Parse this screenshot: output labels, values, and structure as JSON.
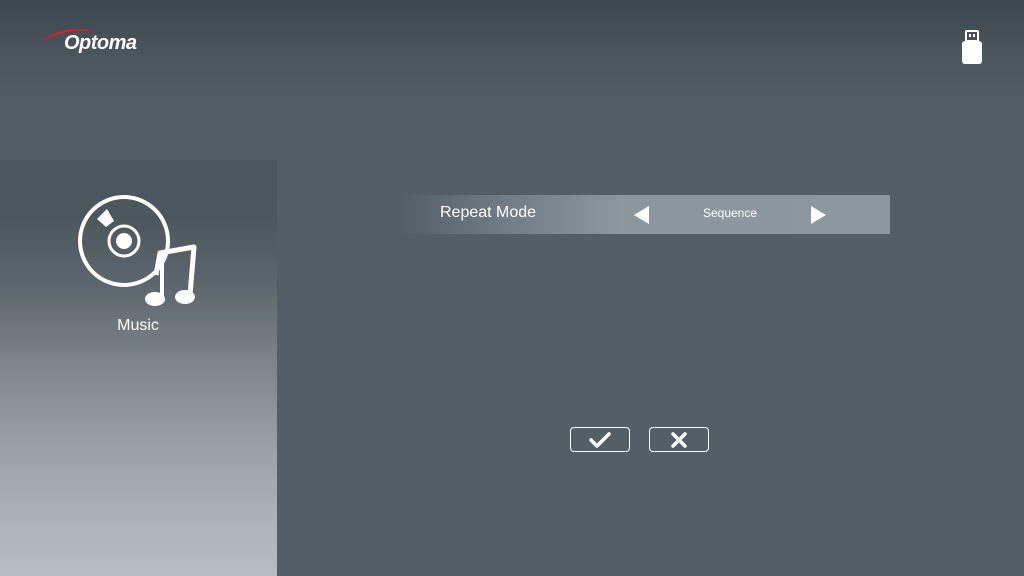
{
  "header": {
    "brand_name": "Optoma",
    "brand_logo_icon": "optoma-logo",
    "status_icon": "usb-drive-icon"
  },
  "sidebar": {
    "category_icon": "music-disc-note-icon",
    "category_label": "Music"
  },
  "settings": {
    "rows": [
      {
        "label": "Repeat Mode",
        "value": "Sequence",
        "prev_icon": "triangle-left-icon",
        "next_icon": "triangle-right-icon"
      }
    ]
  },
  "actions": {
    "confirm_icon": "checkmark-icon",
    "cancel_icon": "cross-icon"
  },
  "colors": {
    "background": "#535e66",
    "row_highlight": "#8c969d",
    "brand_red": "#d8202a",
    "foreground": "#ffffff"
  }
}
